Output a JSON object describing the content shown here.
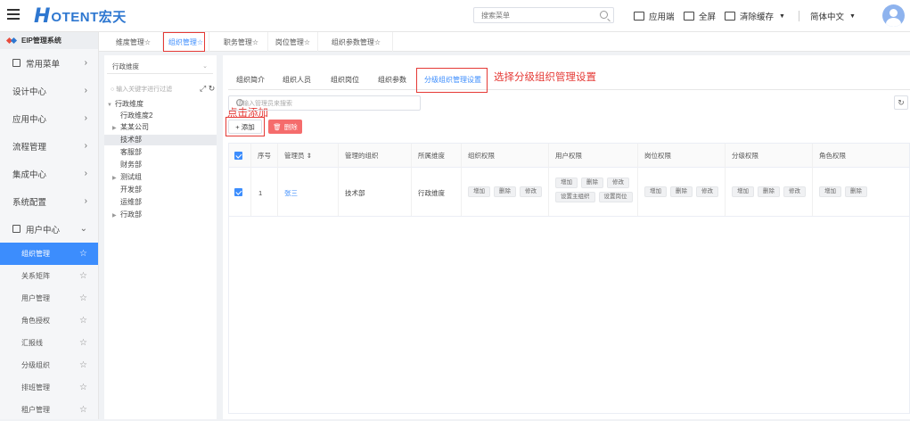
{
  "header": {
    "logo_letter": "H",
    "logo_text": "OTENT宏天",
    "search_placeholder": "搜索菜单",
    "tools": [
      {
        "label": "应用端"
      },
      {
        "label": "全屏"
      },
      {
        "label": "清除缓存"
      },
      {
        "label": "简体中文"
      }
    ]
  },
  "sidebar": {
    "system_title": "EIP管理系统",
    "menus": [
      {
        "label": "常用菜单"
      },
      {
        "label": "设计中心"
      },
      {
        "label": "应用中心"
      },
      {
        "label": "流程管理"
      },
      {
        "label": "集成中心"
      },
      {
        "label": "系统配置"
      },
      {
        "label": "用户中心"
      }
    ],
    "submenus": [
      {
        "label": "组织管理"
      },
      {
        "label": "关系矩阵"
      },
      {
        "label": "用户管理"
      },
      {
        "label": "角色授权"
      },
      {
        "label": "汇报线"
      },
      {
        "label": "分级组织"
      },
      {
        "label": "排班管理"
      },
      {
        "label": "租户管理"
      }
    ]
  },
  "top_tabs": [
    {
      "label": "维度管理☆"
    },
    {
      "label": "组织管理☆"
    },
    {
      "label": "职务管理☆"
    },
    {
      "label": "岗位管理☆"
    },
    {
      "label": "组织参数管理☆"
    }
  ],
  "tree": {
    "dimension": "行政维度",
    "filter_placeholder": "输入关键字进行过滤",
    "nodes": [
      {
        "label": "行政维度"
      },
      {
        "label": "行政维度2"
      },
      {
        "label": "某某公司"
      },
      {
        "label": "技术部"
      },
      {
        "label": "客服部"
      },
      {
        "label": "财务部"
      },
      {
        "label": "测试组"
      },
      {
        "label": "开发部"
      },
      {
        "label": "运维部"
      },
      {
        "label": "行政部"
      }
    ]
  },
  "main": {
    "subtabs": [
      {
        "label": "组织简介"
      },
      {
        "label": "组织人员"
      },
      {
        "label": "组织岗位"
      },
      {
        "label": "组织参数"
      },
      {
        "label": "分级组织管理设置"
      }
    ],
    "annotation_tab": "选择分级组织管理设置",
    "annotation_add": "点击添加",
    "search_placeholder": "请输入管理员来搜索",
    "add_label": "+ 添加",
    "delete_label": "删除",
    "columns": [
      "序号",
      "管理员",
      "管理的组织",
      "所属维度",
      "组织权限",
      "用户权限",
      "岗位权限",
      "分级权限",
      "角色权限"
    ],
    "rows": [
      {
        "index": "1",
        "admin": "张三",
        "org": "技术部",
        "dimension": "行政维度",
        "org_perms": [
          "增加",
          "删除",
          "修改"
        ],
        "user_perms": [
          "增加",
          "删除",
          "修改",
          "设置主组织",
          "设置岗位"
        ],
        "post_perms": [
          "增加",
          "删除",
          "修改"
        ],
        "grade_perms": [
          "增加",
          "删除",
          "修改"
        ],
        "role_perms": [
          "增加",
          "删除"
        ]
      }
    ]
  },
  "colors": {
    "accent": "#3c8dfd",
    "brand": "#2e77d0",
    "danger": "#f56c6c",
    "annotation": "#e53935"
  }
}
